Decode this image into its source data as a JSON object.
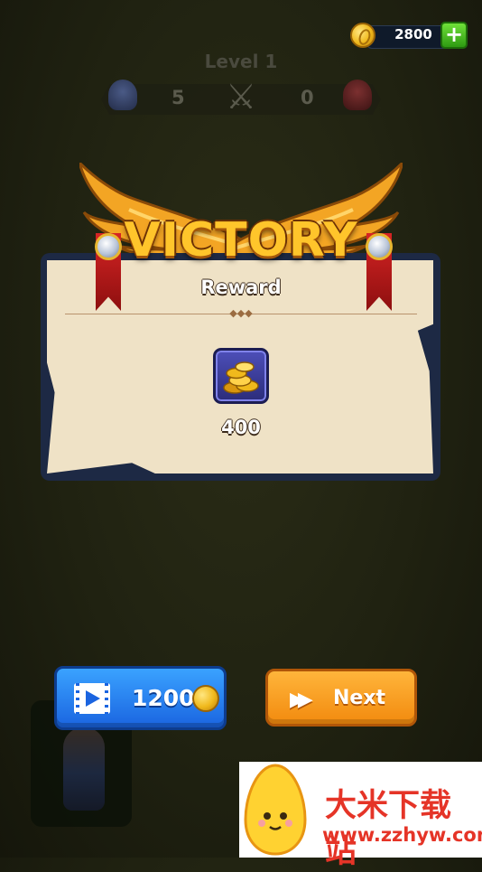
{
  "hud": {
    "coins": "2800",
    "level_label": "Level 1",
    "team_score_left": "5",
    "team_score_right": "0"
  },
  "result": {
    "title": "VICTORY",
    "reward_label": "Reward",
    "reward_amount": "400"
  },
  "buttons": {
    "video_reward": "1200",
    "next": "Next"
  },
  "watermark": {
    "site_name": "大米下载站",
    "url": "www.zzhyw.com"
  },
  "icons": {
    "coin": "coin-icon",
    "add": "plus-icon",
    "video": "video-icon",
    "fast_forward": "fast-forward-icon",
    "crossed_swords": "crossed-swords-icon",
    "coin_pile": "coin-pile-icon"
  },
  "colors": {
    "gold": "#ffc52b",
    "blue_button": "#1a64e0",
    "orange_button": "#f28a0e",
    "plus_green": "#2e9a12",
    "watermark_red": "#e53427"
  }
}
